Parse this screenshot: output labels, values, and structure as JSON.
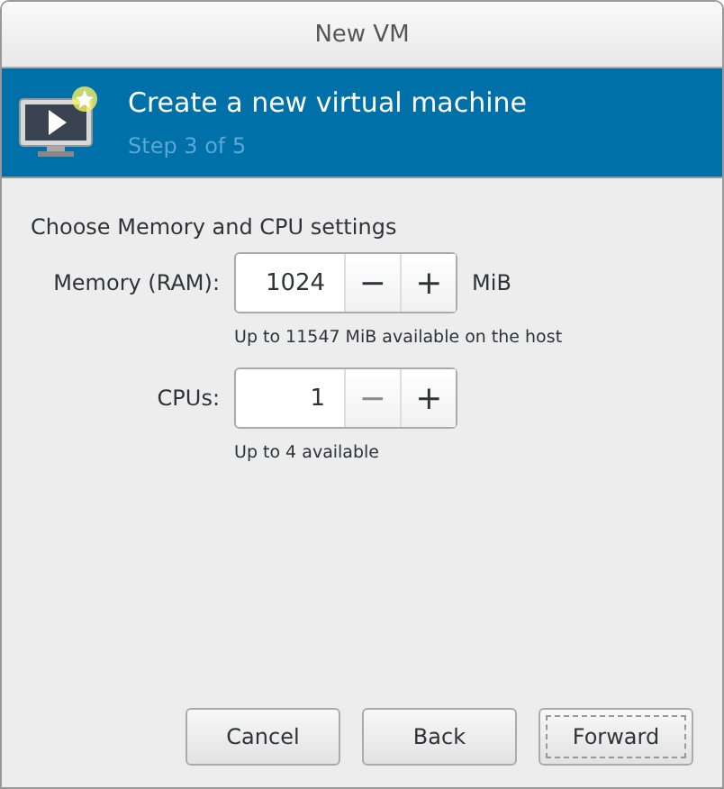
{
  "window": {
    "title": "New VM"
  },
  "banner": {
    "title": "Create a new virtual machine",
    "subtitle": "Step 3 of 5"
  },
  "section_label": "Choose Memory and CPU settings",
  "spinners": [
    {
      "label": "Memory (RAM):",
      "value": "1024",
      "decrement": "−",
      "increment": "+",
      "decrement_disabled": false,
      "unit": "MiB",
      "hint": "Up to 11547 MiB available on the host"
    },
    {
      "label": "CPUs:",
      "value": "1",
      "decrement": "−",
      "increment": "+",
      "decrement_disabled": true,
      "hint": "Up to 4 available"
    }
  ],
  "buttons": [
    {
      "label": "Cancel",
      "focused": false
    },
    {
      "label": "Back",
      "focused": false
    },
    {
      "label": "Forward",
      "focused": true
    }
  ]
}
